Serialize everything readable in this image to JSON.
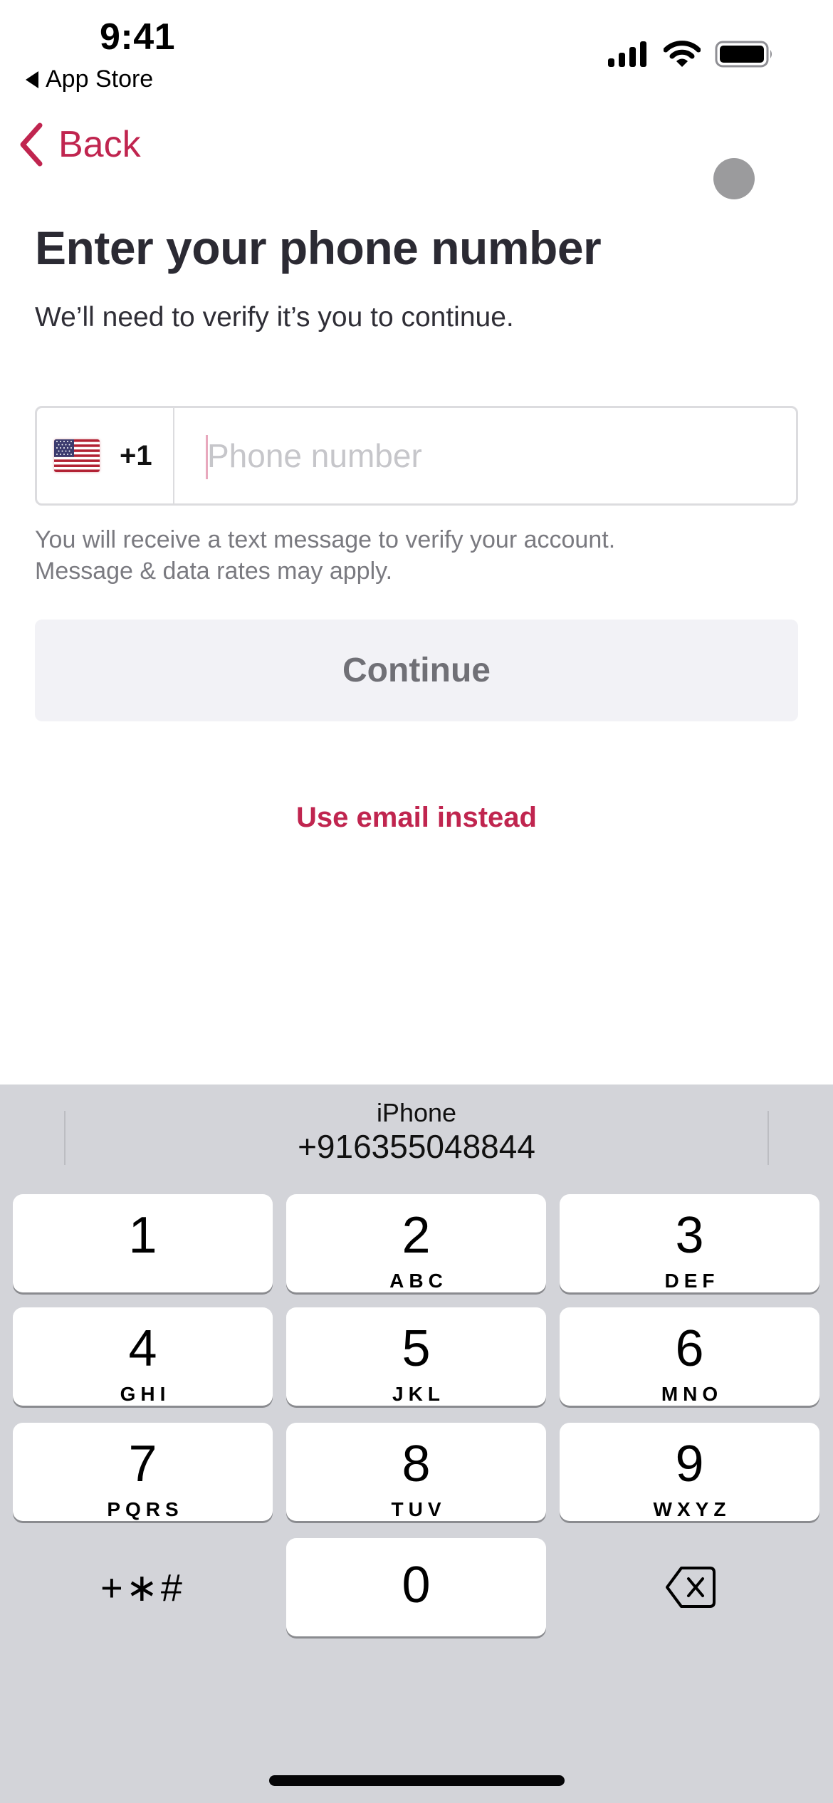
{
  "status_bar": {
    "time": "9:41",
    "back_app": "App Store",
    "icons": [
      "cellular-signal-icon",
      "wifi-icon",
      "battery-icon"
    ]
  },
  "nav": {
    "back_label": "Back",
    "back_icon": "chevron-left-icon",
    "indicator": "gray-dot"
  },
  "header": {
    "title": "Enter your phone number",
    "subtitle": "We’ll need to verify it’s you to continue."
  },
  "phone_input": {
    "country_flag": "us-flag-icon",
    "country_code": "+1",
    "value": "",
    "placeholder": "Phone number"
  },
  "helper_text": {
    "line1": "You will receive a text message to verify your account.",
    "line2": "Message & data rates may apply."
  },
  "buttons": {
    "continue_label": "Continue",
    "continue_disabled": true,
    "use_email_label": "Use email instead"
  },
  "colors": {
    "accent": "#c0254f",
    "title": "#2b2a33",
    "disabled_bg": "#f2f2f6",
    "disabled_text": "#707076",
    "keyboard_bg": "#d3d4d9"
  },
  "keyboard": {
    "suggestion": {
      "label": "iPhone",
      "value": "+916355048844"
    },
    "keys": [
      {
        "num": "1",
        "letters": ""
      },
      {
        "num": "2",
        "letters": "ABC"
      },
      {
        "num": "3",
        "letters": "DEF"
      },
      {
        "num": "4",
        "letters": "GHI"
      },
      {
        "num": "5",
        "letters": "JKL"
      },
      {
        "num": "6",
        "letters": "MNO"
      },
      {
        "num": "7",
        "letters": "PQRS"
      },
      {
        "num": "8",
        "letters": "TUV"
      },
      {
        "num": "9",
        "letters": "WXYZ"
      },
      {
        "num": "0",
        "letters": ""
      }
    ],
    "symbols_label": "+∗#",
    "delete_icon": "backspace-icon"
  }
}
